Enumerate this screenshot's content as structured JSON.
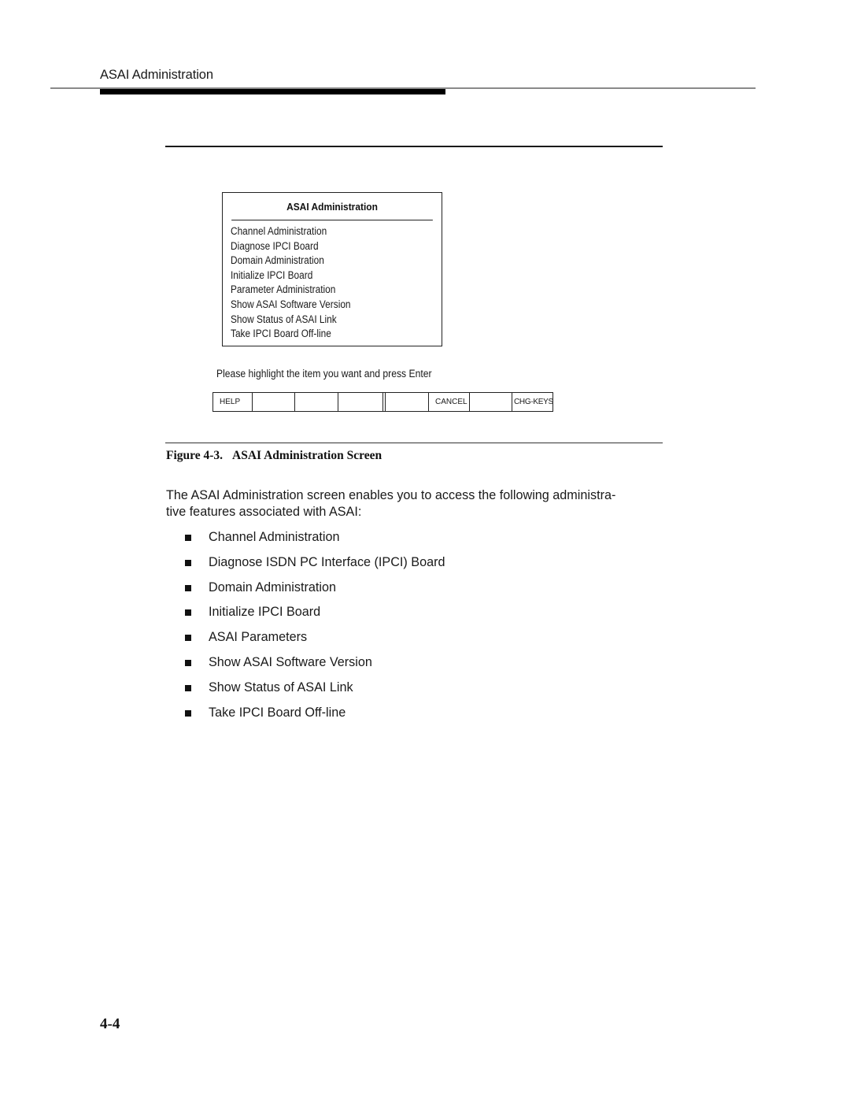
{
  "running_header": {
    "title": "ASAI Administration"
  },
  "figure": {
    "screen": {
      "menu_title": "ASAI Administration",
      "menu_items": [
        "Channel Administration",
        "Diagnose IPCI Board",
        "Domain Administration",
        "Initialize IPCI Board",
        "Parameter Administration",
        "Show ASAI Software Version",
        "Show Status of ASAI Link",
        "Take IPCI Board Off-line"
      ],
      "prompt": "Please highlight the item you want and press Enter",
      "function_keys": [
        "HELP",
        "",
        "",
        "",
        "",
        "CANCEL",
        "",
        "CHG-KEYS"
      ]
    },
    "caption": {
      "number": "Figure 4-3.",
      "title": "ASAI Administration Screen"
    }
  },
  "body": {
    "intro": "The ASAI Administration screen enables you to access the following administra-tive features associated with ASAI:",
    "intro_line1": "The ASAI Administration screen enables you to access the following administra-",
    "intro_line2": "tive features associated with ASAI:",
    "features": [
      "Channel Administration",
      "Diagnose ISDN PC Interface (IPCI) Board",
      "Domain Administration",
      "Initialize IPCI Board",
      "ASAI Parameters",
      "Show ASAI Software Version",
      "Show Status of ASAI Link",
      "Take IPCI Board Off-line"
    ]
  },
  "footer": {
    "page_number": "4-4"
  }
}
